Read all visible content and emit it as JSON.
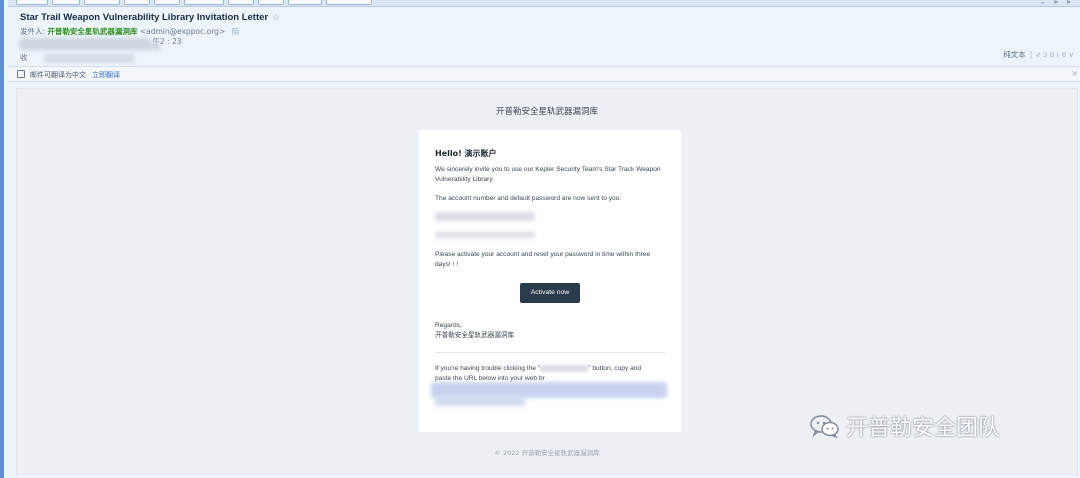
{
  "email": {
    "subject": "Star Trail Weapon Vulnerability Library Invitation Letter",
    "sender_label": "发件人:",
    "sender_name": "开普勒安全星轨武器漏洞库",
    "sender_address": "<admin@exppoc.org>",
    "sender_tag": "陌",
    "time_fragment": "午2 : 23",
    "to_label": "收",
    "plain_text_label": "纯文本",
    "more_label": "ℯ ɔ ɑ ɩ ɐ ∨"
  },
  "translate_bar": {
    "text": "邮件可翻译为中文",
    "link": "立即翻译",
    "close": "×"
  },
  "body": {
    "brand_title": "开普勒安全星轨武器漏洞库",
    "hello": "Hello! 演示账户",
    "invite_text": "We sincerely invite you to use our Kepler Security Team's Star Track Weapon Vulnerability Library.",
    "account_text": "The account number and default password are now sent to you:",
    "activate_text": "Please activate your account and reset your password in time within three days! ! !",
    "activate_button": "Activate now",
    "regards": "Regards,",
    "signature": "开普勒安全星轨武器漏洞库",
    "trouble_text_1": "If you're having trouble clicking the \"",
    "trouble_text_2": "\" button, copy and",
    "trouble_text_3": "paste the URL below into your web br",
    "copyright": "© 2022 开普勒安全星轨武器漏洞库"
  },
  "watermark": {
    "text": "开普勒安全团队",
    "icon": "wechat-icon"
  }
}
